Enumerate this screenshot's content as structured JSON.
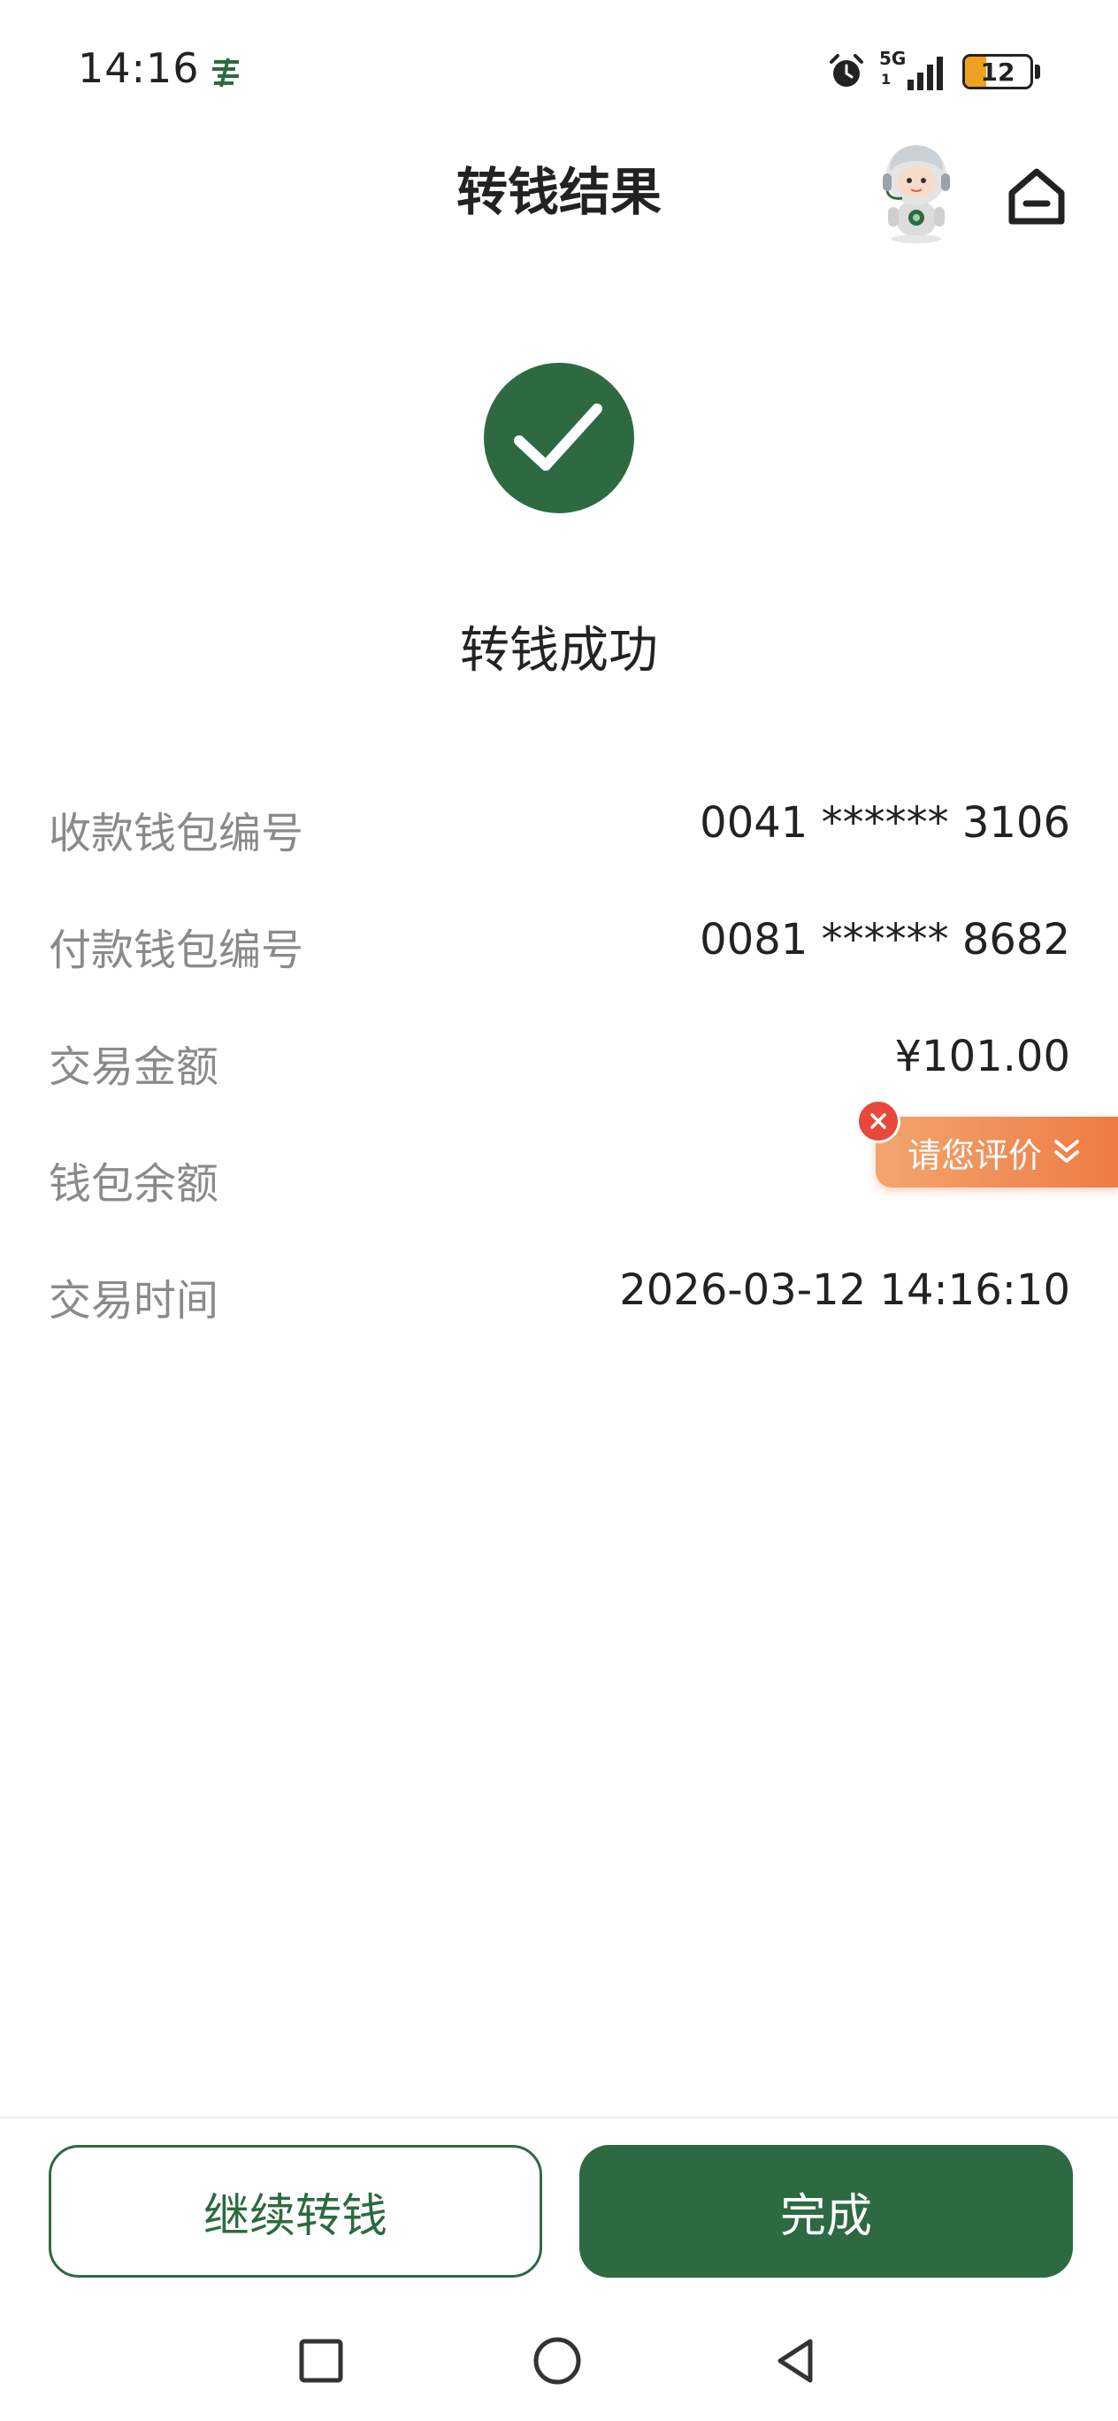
{
  "status_bar": {
    "time": "14:16",
    "network": "5G",
    "network_sub": "1",
    "battery": "12",
    "battery_level": 0.12,
    "app_icon": "postal-logo-icon",
    "alarm_icon": "alarm-icon"
  },
  "header": {
    "title": "转钱结果",
    "avatar_icon": "robot-assistant-icon",
    "home_icon": "home-icon"
  },
  "result": {
    "icon": "checkmark-circle-icon",
    "text": "转钱成功"
  },
  "details": [
    {
      "label": "收款钱包编号",
      "value": "0041 ****** 3106"
    },
    {
      "label": "付款钱包编号",
      "value": "0081 ****** 8682"
    },
    {
      "label": "交易金额",
      "value": "¥101.00"
    },
    {
      "label": "钱包余额",
      "value": ""
    },
    {
      "label": "交易时间",
      "value": "2026-03-12 14:16:10"
    }
  ],
  "rating": {
    "text": "请您评价",
    "close_icon": "close-icon",
    "chevron_icon": "double-chevron-down-icon"
  },
  "actions": {
    "continue_label": "继续转钱",
    "done_label": "完成"
  },
  "colors": {
    "primary": "#2d6a41",
    "rating_start": "#f3a56f",
    "rating_end": "#ee7b44",
    "close_red": "#e8473c",
    "label_gray": "#8a8a8a"
  },
  "system_nav": [
    "recent-apps-icon",
    "home-circle-icon",
    "back-icon"
  ]
}
